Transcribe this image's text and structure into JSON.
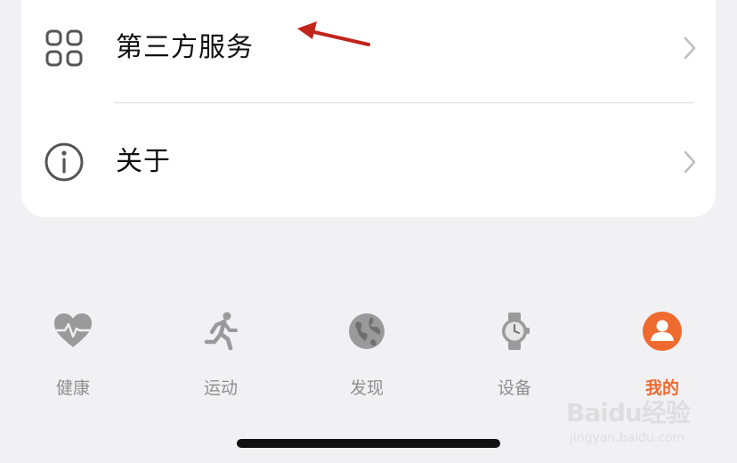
{
  "settings_list": {
    "items": [
      {
        "label": "第三方服务",
        "icon": "grid-icon"
      },
      {
        "label": "关于",
        "icon": "info-icon"
      }
    ]
  },
  "tab_bar": {
    "tabs": [
      {
        "label": "健康",
        "icon": "heart-pulse-icon",
        "active": false
      },
      {
        "label": "运动",
        "icon": "running-person-icon",
        "active": false
      },
      {
        "label": "发现",
        "icon": "globe-icon",
        "active": false
      },
      {
        "label": "设备",
        "icon": "watch-icon",
        "active": false
      },
      {
        "label": "我的",
        "icon": "profile-icon",
        "active": true
      }
    ]
  },
  "watermark": {
    "brand": "Baidu经验",
    "url": "jingyan.baidu.com"
  },
  "colors": {
    "accent": "#ef6a2f",
    "annotation_arrow": "#c0241b",
    "inactive_icon": "#9a9a9a",
    "background": "#f1f1f3"
  }
}
